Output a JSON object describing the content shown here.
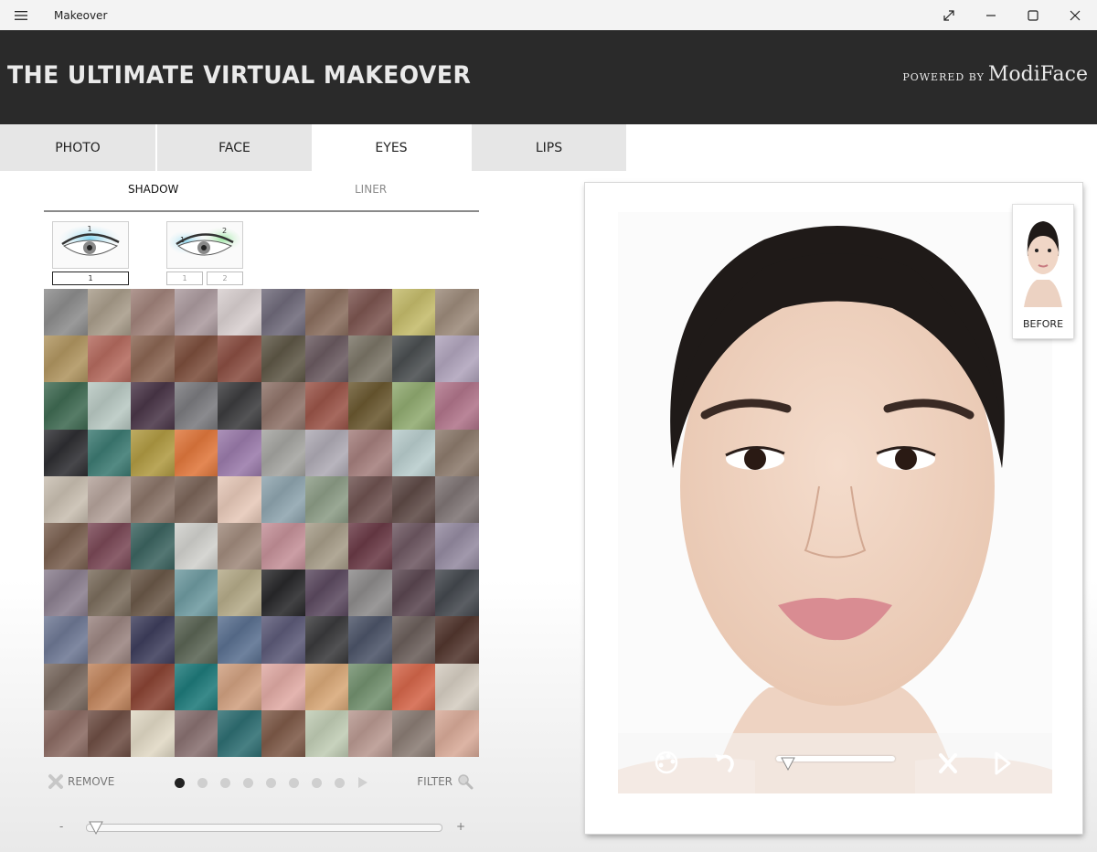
{
  "window": {
    "title": "Makeover"
  },
  "banner": {
    "title": "THE ULTIMATE VIRTUAL MAKEOVER",
    "powered_by": "POWERED BY",
    "brand": "ModiFace"
  },
  "tabs": [
    {
      "label": "PHOTO",
      "active": false
    },
    {
      "label": "FACE",
      "active": false
    },
    {
      "label": "EYES",
      "active": true
    },
    {
      "label": "LIPS",
      "active": false
    }
  ],
  "subtabs": [
    {
      "label": "SHADOW",
      "active": true
    },
    {
      "label": "LINER",
      "active": false
    }
  ],
  "styles": [
    {
      "number": "1",
      "slots": [
        "1"
      ],
      "selected": true
    },
    {
      "number": "2",
      "slots": [
        "1",
        "2"
      ],
      "selected": false
    }
  ],
  "swatch_colors": [
    "#8c8c8c",
    "#a89c8a",
    "#a0827a",
    "#ab9a9e",
    "#d8cfcf",
    "#6f6a7a",
    "#8a6e5e",
    "#7c5550",
    "#c4bb6b",
    "#9c8a7a",
    "#b09560",
    "#b46a5e",
    "#8a6552",
    "#7c4e3c",
    "#8a4e42",
    "#5e5746",
    "#6a5a60",
    "#7a7466",
    "#4a4e50",
    "#b0a4bc",
    "#3f6a52",
    "#b8c8c2",
    "#4a3648",
    "#7a7a7e",
    "#3c3c3e",
    "#8e7268",
    "#9a5448",
    "#6a5830",
    "#90aa70",
    "#b0748a",
    "#2e2e32",
    "#3c7a72",
    "#b09a42",
    "#e0773c",
    "#9a7aaa",
    "#a4a4a0",
    "#aeaab4",
    "#a47e7c",
    "#b8cccc",
    "#8c7a6c",
    "#c8beb0",
    "#b4a29a",
    "#8a7468",
    "#7a6458",
    "#e6c8b8",
    "#8ea4ae",
    "#8c9c86",
    "#6e5250",
    "#5e4a46",
    "#7e7474",
    "#7a6050",
    "#7a4856",
    "#3c6460",
    "#d0d0cc",
    "#a08a7c",
    "#c49098",
    "#a69c88",
    "#6a3a46",
    "#6e5862",
    "#948aa0",
    "#8a7e8e",
    "#7a6c5c",
    "#6a5848",
    "#6e9aa0",
    "#b4aa88",
    "#28282a",
    "#5c4a60",
    "#8c8a8a",
    "#5a4650",
    "#44484e",
    "#6e7894",
    "#9a8480",
    "#3e3e5c",
    "#5a6454",
    "#5a7090",
    "#5c5a78",
    "#3a3a3c",
    "#4c5468",
    "#6a5e5a",
    "#52362e",
    "#7a6a60",
    "#c0845c",
    "#8a4434",
    "#1e7a7a",
    "#d0a080",
    "#e0aaa4",
    "#d8a878",
    "#72906e",
    "#d4664a",
    "#d4ccc0",
    "#8a6a62",
    "#6e4e44",
    "#e0d8c4",
    "#887070",
    "#2e6e72",
    "#7e5a48",
    "#c0ccb4",
    "#b89890",
    "#8a7c74",
    "#d8aa98"
  ],
  "controls": {
    "remove_label": "REMOVE",
    "filter_label": "FILTER",
    "pages": 8,
    "active_page": 1,
    "intensity_minus": "-",
    "intensity_plus": "+",
    "intensity_value": 0.02
  },
  "preview": {
    "before_label": "BEFORE",
    "blend_value": 0.1
  },
  "icons": {
    "menu": "hamburger-icon",
    "fullscreen": "expand-icon",
    "minimize": "minimize-icon",
    "maximize": "maximize-icon",
    "close": "close-icon",
    "remove": "x-icon",
    "filter": "magnifier-icon",
    "next": "play-arrow-icon",
    "palette": "palette-icon",
    "undo": "undo-icon",
    "discard": "x-icon",
    "share": "share-icon"
  }
}
